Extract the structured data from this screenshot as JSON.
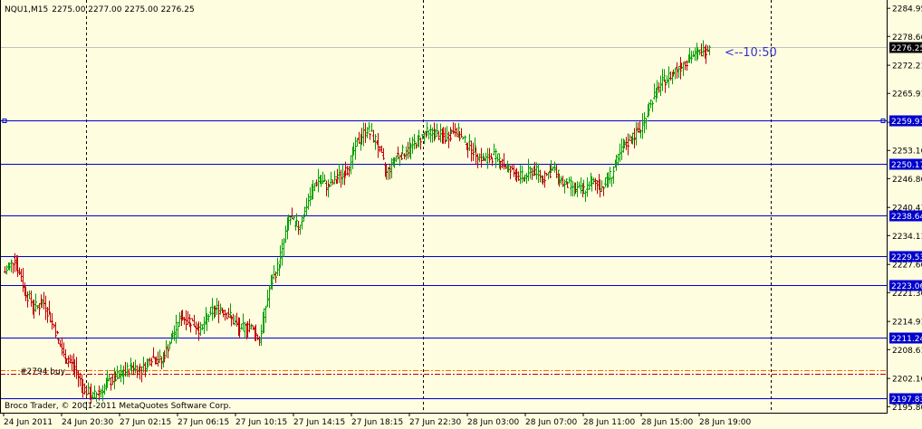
{
  "header": {
    "symbol": "NQU1,M15",
    "ohlc": "2275.00 2277.00 2275.00 2276.25"
  },
  "annotation_time": "<--10:50",
  "copyright": "Broco Trader, © 2001-2011 MetaQuotes Software Corp.",
  "order_label": "#2794 buy",
  "current_price_label": "2276.25",
  "colors": {
    "background": "#fffde0",
    "candle_up": "#00a000",
    "candle_down": "#c00000",
    "hline": "#0000cc",
    "order_line": "#ff6600",
    "order_line2": "#c00000",
    "bid_line": "#c0c0c0",
    "annotation": "#3333cc"
  },
  "chart_data": {
    "type": "candlestick",
    "y_axis_ticks": [
      "2284.95",
      "2278.66",
      "2272.21",
      "2265.91",
      "2259.46",
      "2253.16",
      "2246.86",
      "2240.41",
      "2234.11",
      "2227.66",
      "2221.36",
      "2214.91",
      "2208.61",
      "2202.16",
      "2195.86"
    ],
    "x_axis_ticks": [
      "24 Jun 2011",
      "24 Jun 20:30",
      "27 Jun 02:15",
      "27 Jun 06:15",
      "27 Jun 10:15",
      "27 Jun 14:15",
      "27 Jun 18:15",
      "27 Jun 22:30",
      "28 Jun 03:00",
      "28 Jun 07:00",
      "28 Jun 11:00",
      "28 Jun 15:00",
      "28 Jun 19:00"
    ],
    "ylim": [
      2194.5,
      2286.0
    ],
    "horizontal_lines": [
      {
        "label": "2259.91",
        "value": 2259.91
      },
      {
        "label": "2250.17",
        "value": 2250.17
      },
      {
        "label": "2238.64",
        "value": 2238.64
      },
      {
        "label": "2229.53",
        "value": 2229.53
      },
      {
        "label": "2223.06",
        "value": 2223.06
      },
      {
        "label": "2211.24",
        "value": 2211.24
      },
      {
        "label": "2197.83",
        "value": 2197.83
      }
    ],
    "order_lines": [
      2204.1,
      2203.3
    ],
    "bid_line": 2276.25,
    "key_points": [
      [
        0,
        2226
      ],
      [
        6,
        2229
      ],
      [
        12,
        2222
      ],
      [
        18,
        2218
      ],
      [
        24,
        2219
      ],
      [
        30,
        2214
      ],
      [
        36,
        2207
      ],
      [
        42,
        2205
      ],
      [
        48,
        2200
      ],
      [
        54,
        2198
      ],
      [
        60,
        2200
      ],
      [
        66,
        2202
      ],
      [
        72,
        2203
      ],
      [
        78,
        2205
      ],
      [
        84,
        2204
      ],
      [
        90,
        2207
      ],
      [
        96,
        2206
      ],
      [
        102,
        2211
      ],
      [
        108,
        2216
      ],
      [
        114,
        2215
      ],
      [
        120,
        2213
      ],
      [
        126,
        2217
      ],
      [
        132,
        2218
      ],
      [
        138,
        2216
      ],
      [
        144,
        2213
      ],
      [
        150,
        2214
      ],
      [
        156,
        2211
      ],
      [
        162,
        2222
      ],
      [
        168,
        2228
      ],
      [
        174,
        2238
      ],
      [
        180,
        2236
      ],
      [
        186,
        2242
      ],
      [
        192,
        2247
      ],
      [
        198,
        2245
      ],
      [
        204,
        2247
      ],
      [
        210,
        2249
      ],
      [
        216,
        2255
      ],
      [
        222,
        2258
      ],
      [
        228,
        2255
      ],
      [
        234,
        2248
      ],
      [
        240,
        2252
      ],
      [
        246,
        2253
      ],
      [
        252,
        2255
      ],
      [
        258,
        2257
      ],
      [
        264,
        2257
      ],
      [
        270,
        2256
      ],
      [
        276,
        2258
      ],
      [
        282,
        2255
      ],
      [
        288,
        2253
      ],
      [
        294,
        2251
      ],
      [
        300,
        2252
      ],
      [
        306,
        2250
      ],
      [
        312,
        2248
      ],
      [
        318,
        2247
      ],
      [
        324,
        2249
      ],
      [
        330,
        2247
      ],
      [
        336,
        2249
      ],
      [
        342,
        2246
      ],
      [
        348,
        2245
      ],
      [
        354,
        2244
      ],
      [
        360,
        2246
      ],
      [
        366,
        2245
      ],
      [
        372,
        2248
      ],
      [
        378,
        2253
      ],
      [
        384,
        2256
      ],
      [
        390,
        2258
      ],
      [
        396,
        2264
      ],
      [
        402,
        2268
      ],
      [
        408,
        2270
      ],
      [
        414,
        2272
      ],
      [
        420,
        2274
      ],
      [
        426,
        2275
      ],
      [
        432,
        2276.25
      ]
    ]
  }
}
